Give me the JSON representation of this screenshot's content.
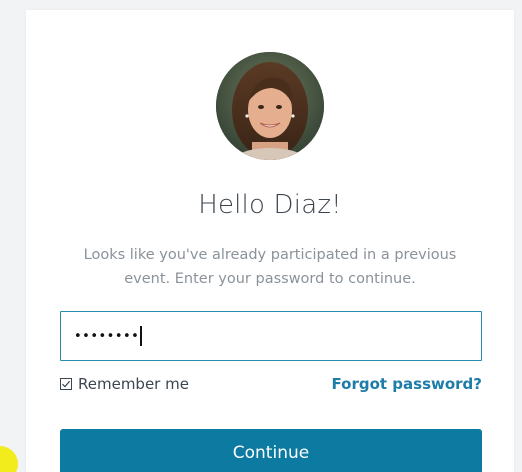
{
  "greeting": "Hello Diaz!",
  "subtitle": "Looks like you've already participated in a previous event. Enter your password to continue.",
  "password": {
    "masked_value": "••••••••"
  },
  "remember_me": {
    "label": "Remember me",
    "checked": true
  },
  "forgot_password": {
    "label": "Forgot password?"
  },
  "continue_button": {
    "label": "Continue"
  },
  "colors": {
    "accent": "#0d7aa2",
    "link": "#1d7ca8",
    "input_border": "#2a8bb0",
    "text": "#3d4650",
    "muted_text": "#8a929a",
    "background": "#f2f3f4"
  },
  "icons": {
    "avatar": "user-avatar-photo",
    "checkbox": "checkbox-checked-icon"
  }
}
